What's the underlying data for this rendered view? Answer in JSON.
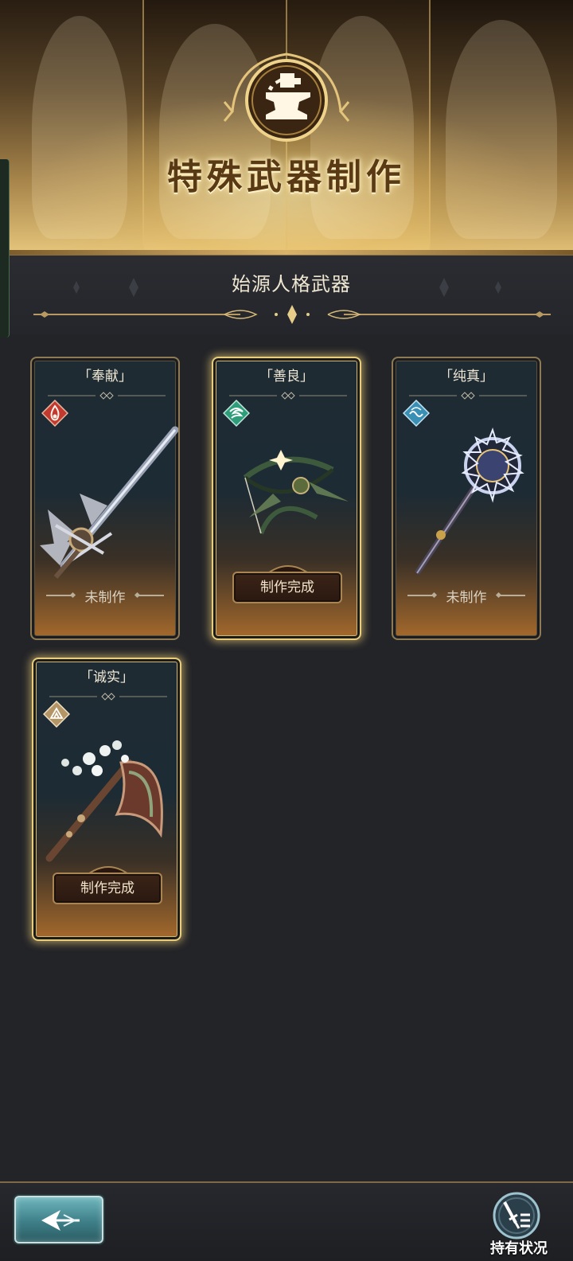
{
  "banner": {
    "title": "特殊武器制作",
    "icon": "anvil-hammer-icon"
  },
  "section": {
    "title": "始源人格武器"
  },
  "cards": [
    {
      "name": "「奉献」",
      "element_icon": "fire-element-icon",
      "element_color": "#c2392f",
      "weapon": "longsword",
      "status": "未制作",
      "crafted": false,
      "selected": false
    },
    {
      "name": "「善良」",
      "element_icon": "wind-element-icon",
      "element_color": "#2e9e7a",
      "weapon": "bow",
      "status": "制作完成",
      "crafted": true,
      "selected": true
    },
    {
      "name": "「纯真」",
      "element_icon": "water-element-icon",
      "element_color": "#3a8fb5",
      "weapon": "staff",
      "status": "未制作",
      "crafted": false,
      "selected": false
    },
    {
      "name": "「诚实」",
      "element_icon": "earth-element-icon",
      "element_color": "#b49566",
      "weapon": "axe",
      "status": "制作完成",
      "crafted": true,
      "selected": true
    }
  ],
  "bottom_bar": {
    "back_icon": "back-arrow-icon",
    "holdings_label": "持有状况",
    "holdings_icon": "sword-list-icon"
  },
  "colors": {
    "accent_gold": "#d6b768",
    "panel_bg": "#232428"
  }
}
